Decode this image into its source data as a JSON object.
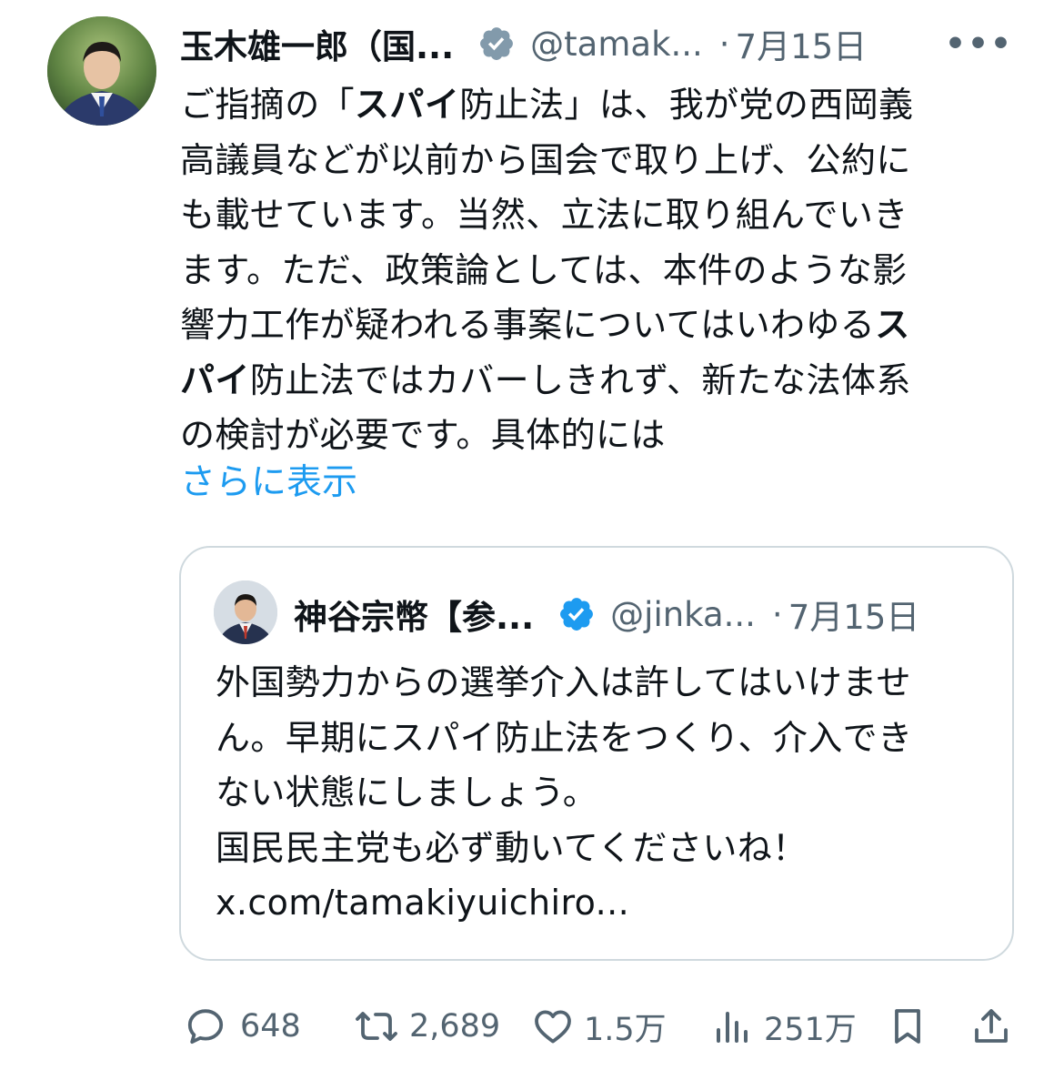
{
  "author": {
    "name": "玉木雄一郎（国...",
    "handle": "@tamak...",
    "separator": "·",
    "date": "7月15日",
    "verified": true,
    "more_label": "•••"
  },
  "tweet": {
    "lines": [
      {
        "segments": [
          {
            "text": "ご指摘の「",
            "bold": false
          },
          {
            "text": "スパイ",
            "bold": true
          },
          {
            "text": "防止法」は、我が党の西岡義",
            "bold": false
          }
        ]
      },
      {
        "segments": [
          {
            "text": "高議員などが以前から国会で取り上げ、公約に",
            "bold": false
          }
        ]
      },
      {
        "segments": [
          {
            "text": "も載せています。当然、立法に取り組んでいき",
            "bold": false
          }
        ]
      },
      {
        "segments": [
          {
            "text": "ます。ただ、政策論としては、本件のような影",
            "bold": false
          }
        ]
      },
      {
        "segments": [
          {
            "text": "響力工作が疑われる事案についてはいわゆる",
            "bold": false
          },
          {
            "text": "ス",
            "bold": true
          }
        ]
      },
      {
        "segments": [
          {
            "text": "パイ",
            "bold": true
          },
          {
            "text": "防止法ではカバーしきれず、新たな法体系",
            "bold": false
          }
        ]
      },
      {
        "segments": [
          {
            "text": "の検討が必要です。具体的には",
            "bold": false
          }
        ]
      }
    ],
    "show_more_label": "さらに表示"
  },
  "quote": {
    "author_name": "神谷宗幣【参...",
    "handle": "@jinka...",
    "separator": "·",
    "date": "7月15日",
    "verified": true,
    "lines": [
      "外国勢力からの選挙介入は許してはいけませ",
      "ん。早期にスパイ防止法をつくり、介入でき",
      "ない状態にしましょう。",
      "国民民主党も必ず動いてくださいね！",
      "x.com/tamakiyuichiro..."
    ]
  },
  "actions": {
    "reply_count": "648",
    "retweet_count": "2,689",
    "like_count": "1.5万",
    "views_count": "251万",
    "icons": [
      "reply-icon",
      "retweet-icon",
      "like-icon",
      "views-icon",
      "bookmark-icon",
      "share-icon"
    ]
  },
  "colors": {
    "text": "#0f1419",
    "secondary": "#536471",
    "link": "#1d9bf0",
    "verified": "#1d9bf0",
    "border": "#cfd9de"
  }
}
